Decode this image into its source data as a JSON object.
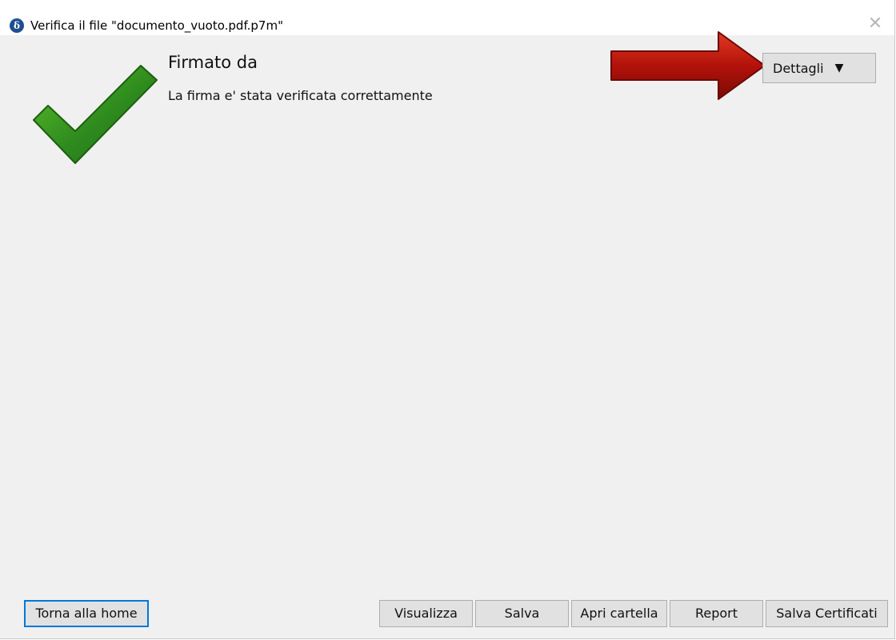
{
  "window": {
    "title": "Verifica il file \"documento_vuoto.pdf.p7m\"",
    "app_icon_glyph": "δ",
    "close_glyph": "✕"
  },
  "result": {
    "heading": "Firmato da",
    "message": "La firma e' stata verificata correttamente",
    "status_icon": "checkmark-icon",
    "status_color": "#2e8b1e"
  },
  "annotation": {
    "arrow_color": "#b2120a"
  },
  "details": {
    "label": "Dettagli",
    "caret": "▼"
  },
  "footer": {
    "home_label": "Torna alla home",
    "view_label": "Visualizza",
    "save_label": "Salva",
    "open_folder_label": "Apri cartella",
    "report_label": "Report",
    "save_certs_label": "Salva Certificati"
  }
}
